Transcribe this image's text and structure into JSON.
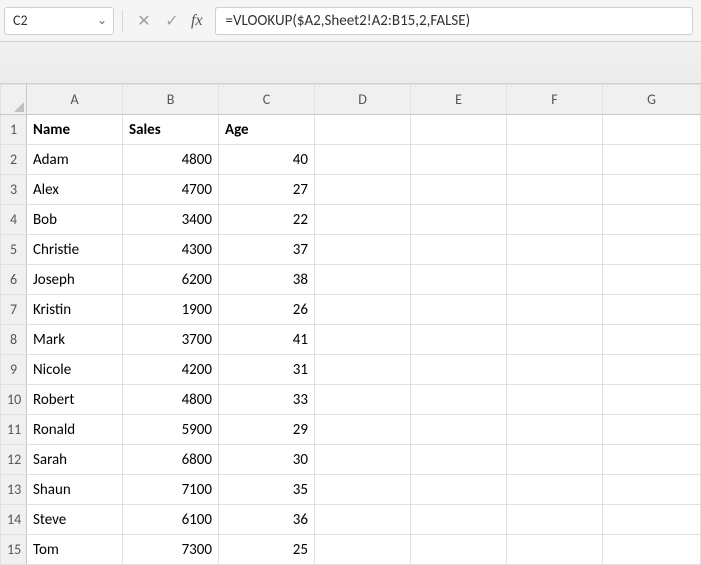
{
  "namebox": {
    "value": "C2"
  },
  "formula_bar": {
    "fx_label": "fx",
    "formula": "=VLOOKUP($A2,Sheet2!A2:B15,2,FALSE)"
  },
  "columns": [
    "A",
    "B",
    "C",
    "D",
    "E",
    "F",
    "G"
  ],
  "row_numbers": [
    1,
    2,
    3,
    4,
    5,
    6,
    7,
    8,
    9,
    10,
    11,
    12,
    13,
    14,
    15
  ],
  "headers": {
    "A": "Name",
    "B": "Sales",
    "C": "Age"
  },
  "rows": [
    {
      "name": "Adam",
      "sales": 4800,
      "age": 40
    },
    {
      "name": "Alex",
      "sales": 4700,
      "age": 27
    },
    {
      "name": "Bob",
      "sales": 3400,
      "age": 22
    },
    {
      "name": "Christie",
      "sales": 4300,
      "age": 37
    },
    {
      "name": "Joseph",
      "sales": 6200,
      "age": 38
    },
    {
      "name": "Kristin",
      "sales": 1900,
      "age": 26
    },
    {
      "name": "Mark",
      "sales": 3700,
      "age": 41
    },
    {
      "name": "Nicole",
      "sales": 4200,
      "age": 31
    },
    {
      "name": "Robert",
      "sales": 4800,
      "age": 33
    },
    {
      "name": "Ronald",
      "sales": 5900,
      "age": 29
    },
    {
      "name": "Sarah",
      "sales": 6800,
      "age": 30
    },
    {
      "name": "Shaun",
      "sales": 7100,
      "age": 35
    },
    {
      "name": "Steve",
      "sales": 6100,
      "age": 36
    },
    {
      "name": "Tom",
      "sales": 7300,
      "age": 25
    }
  ],
  "icons": {
    "cancel": "✕",
    "confirm": "✓",
    "chevron": "⌄"
  }
}
